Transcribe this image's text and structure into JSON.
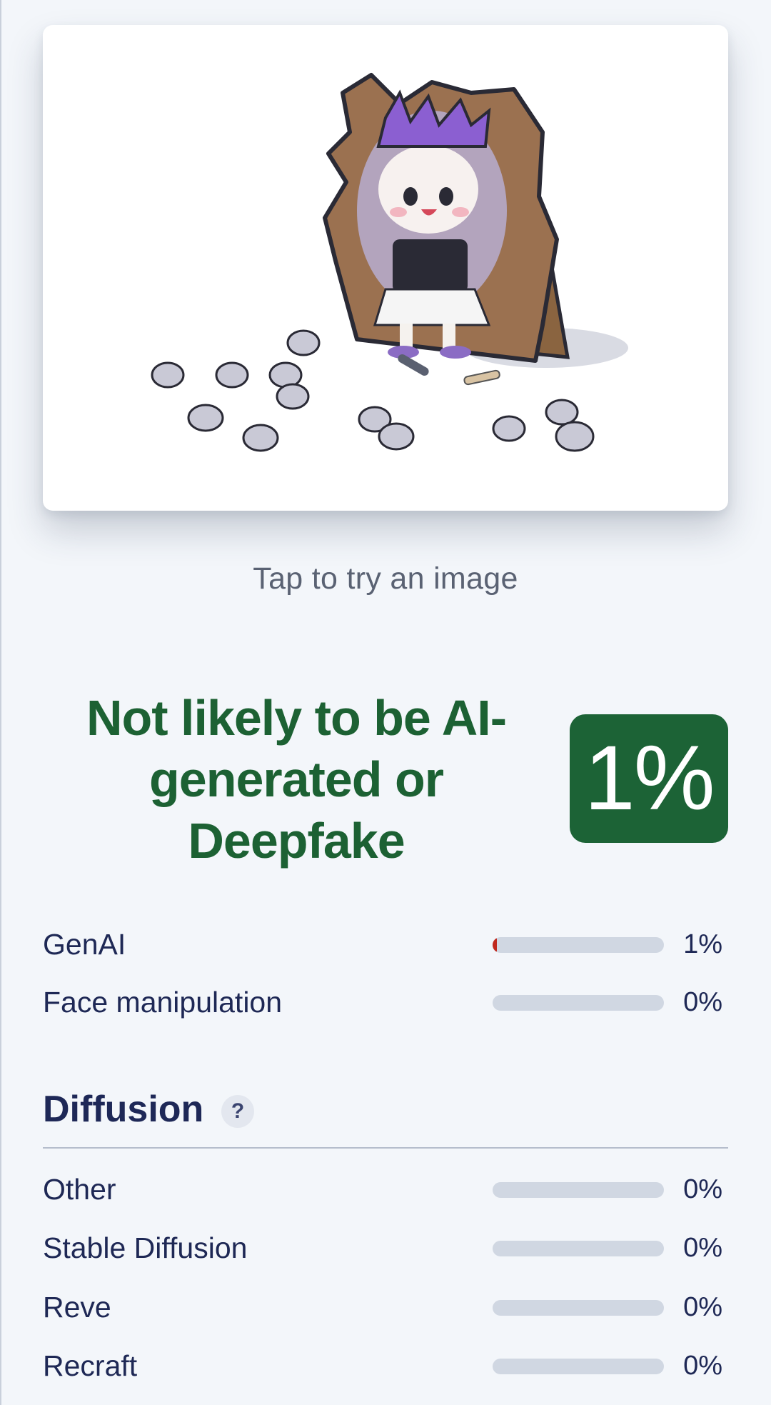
{
  "image_card": {
    "icon": "sample-image-thumbnail"
  },
  "caption": "Tap to try an image",
  "verdict": {
    "line1": "Not likely to be AI-",
    "line2": "generated or",
    "line3": "Deepfake",
    "score": "1%",
    "color": "#1c6133"
  },
  "metrics": [
    {
      "label": "GenAI",
      "value": "1%",
      "fraction": 0.01
    },
    {
      "label": "Face manipulation",
      "value": "0%",
      "fraction": 0
    }
  ],
  "diffusion": {
    "title": "Diffusion",
    "help": "?",
    "items": [
      {
        "label": "Other",
        "value": "0%",
        "fraction": 0
      },
      {
        "label": "Stable Diffusion",
        "value": "0%",
        "fraction": 0
      },
      {
        "label": "Reve",
        "value": "0%",
        "fraction": 0
      },
      {
        "label": "Recraft",
        "value": "0%",
        "fraction": 0
      }
    ]
  },
  "colors": {
    "bar_fill": "#c0281d",
    "bar_track": "#d0d7e2",
    "badge": "#1c6336"
  }
}
